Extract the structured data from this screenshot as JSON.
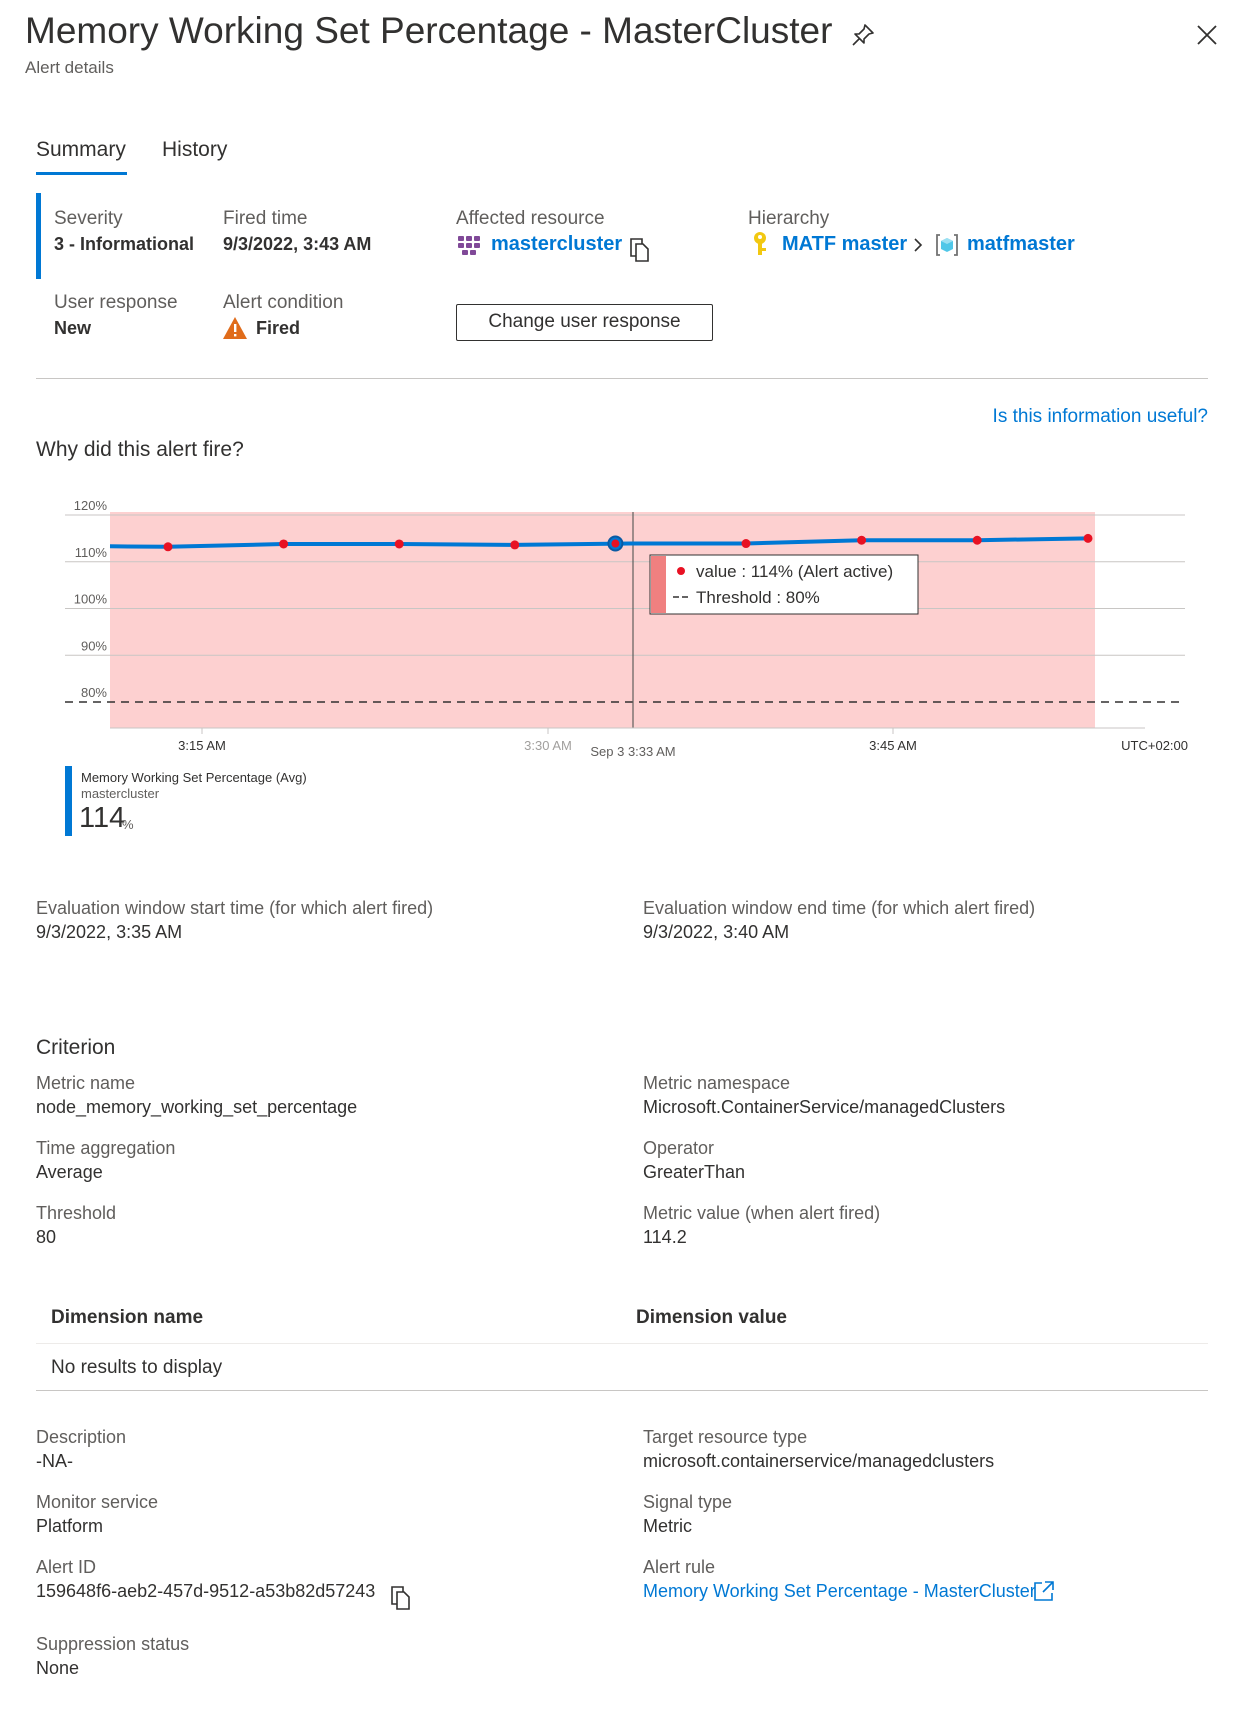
{
  "header": {
    "title": "Memory Working Set Percentage - MasterCluster",
    "subtitle": "Alert details"
  },
  "tabs": [
    {
      "label": "Summary",
      "active": true
    },
    {
      "label": "History",
      "active": false
    }
  ],
  "summary": {
    "severity_label": "Severity",
    "severity_value": "3 - Informational",
    "fired_time_label": "Fired time",
    "fired_time_value": "9/3/2022, 3:43 AM",
    "affected_resource_label": "Affected resource",
    "affected_resource_value": "mastercluster",
    "hierarchy_label": "Hierarchy",
    "hierarchy_items": [
      "MATF master",
      "matfmaster"
    ],
    "user_response_label": "User response",
    "user_response_value": "New",
    "alert_condition_label": "Alert condition",
    "alert_condition_value": "Fired",
    "change_button": "Change user response"
  },
  "feedback_link": "Is this information useful?",
  "why_title": "Why did this alert fire?",
  "chart_data": {
    "type": "line",
    "y_ticks": [
      "120%",
      "110%",
      "100%",
      "90%",
      "80%"
    ],
    "ylim": [
      75,
      120
    ],
    "x_tick_labels": [
      "3:15 AM",
      "3:30 AM",
      "3:45 AM"
    ],
    "x_cursor_label": "Sep 3 3:33 AM",
    "timezone": "UTC+02:00",
    "series": [
      {
        "name": "Memory Working Set Percentage (Avg)",
        "x": [
          "3:10 AM",
          "3:15 AM",
          "3:20 AM",
          "3:25 AM",
          "3:30 AM",
          "3:35 AM",
          "3:40 AM",
          "3:45 AM",
          "3:50 AM",
          "3:55 AM"
        ],
        "values": [
          113.3,
          113.2,
          113.8,
          113.8,
          113.6,
          113.9,
          113.9,
          114.6,
          114.6,
          115.0
        ]
      }
    ],
    "threshold": 80,
    "tooltip": {
      "value_text": "value : 114% (Alert active)",
      "threshold_text": "Threshold : 80%"
    },
    "colors": {
      "line": "#0078d4",
      "point": "#e81123",
      "alert_area": "#fdd0d0",
      "tooltip_bar": "#f08080"
    }
  },
  "legend": {
    "name": "Memory Working Set Percentage (Avg)",
    "resource": "mastercluster",
    "value": "114",
    "unit": "%"
  },
  "evaluation": {
    "start_label": "Evaluation window start time (for which alert fired)",
    "start_value": "9/3/2022, 3:35 AM",
    "end_label": "Evaluation window end time (for which alert fired)",
    "end_value": "9/3/2022, 3:40 AM"
  },
  "criterion": {
    "title": "Criterion",
    "metric_name_label": "Metric name",
    "metric_name_value": "node_memory_working_set_percentage",
    "metric_namespace_label": "Metric namespace",
    "metric_namespace_value": "Microsoft.ContainerService/managedClusters",
    "time_aggregation_label": "Time aggregation",
    "time_aggregation_value": "Average",
    "operator_label": "Operator",
    "operator_value": "GreaterThan",
    "threshold_label": "Threshold",
    "threshold_value": "80",
    "metric_value_label": "Metric value (when alert fired)",
    "metric_value_value": "114.2"
  },
  "dimensions": {
    "col_name": "Dimension name",
    "col_value": "Dimension value",
    "empty": "No results to display"
  },
  "details": {
    "description_label": "Description",
    "description_value": "-NA-",
    "target_type_label": "Target resource type",
    "target_type_value": "microsoft.containerservice/managedclusters",
    "monitor_service_label": "Monitor service",
    "monitor_service_value": "Platform",
    "signal_type_label": "Signal type",
    "signal_type_value": "Metric",
    "alert_id_label": "Alert ID",
    "alert_id_value": "159648f6-aeb2-457d-9512-a53b82d57243",
    "alert_rule_label": "Alert rule",
    "alert_rule_value": "Memory Working Set Percentage - MasterCluster",
    "suppression_label": "Suppression status",
    "suppression_value": "None"
  }
}
